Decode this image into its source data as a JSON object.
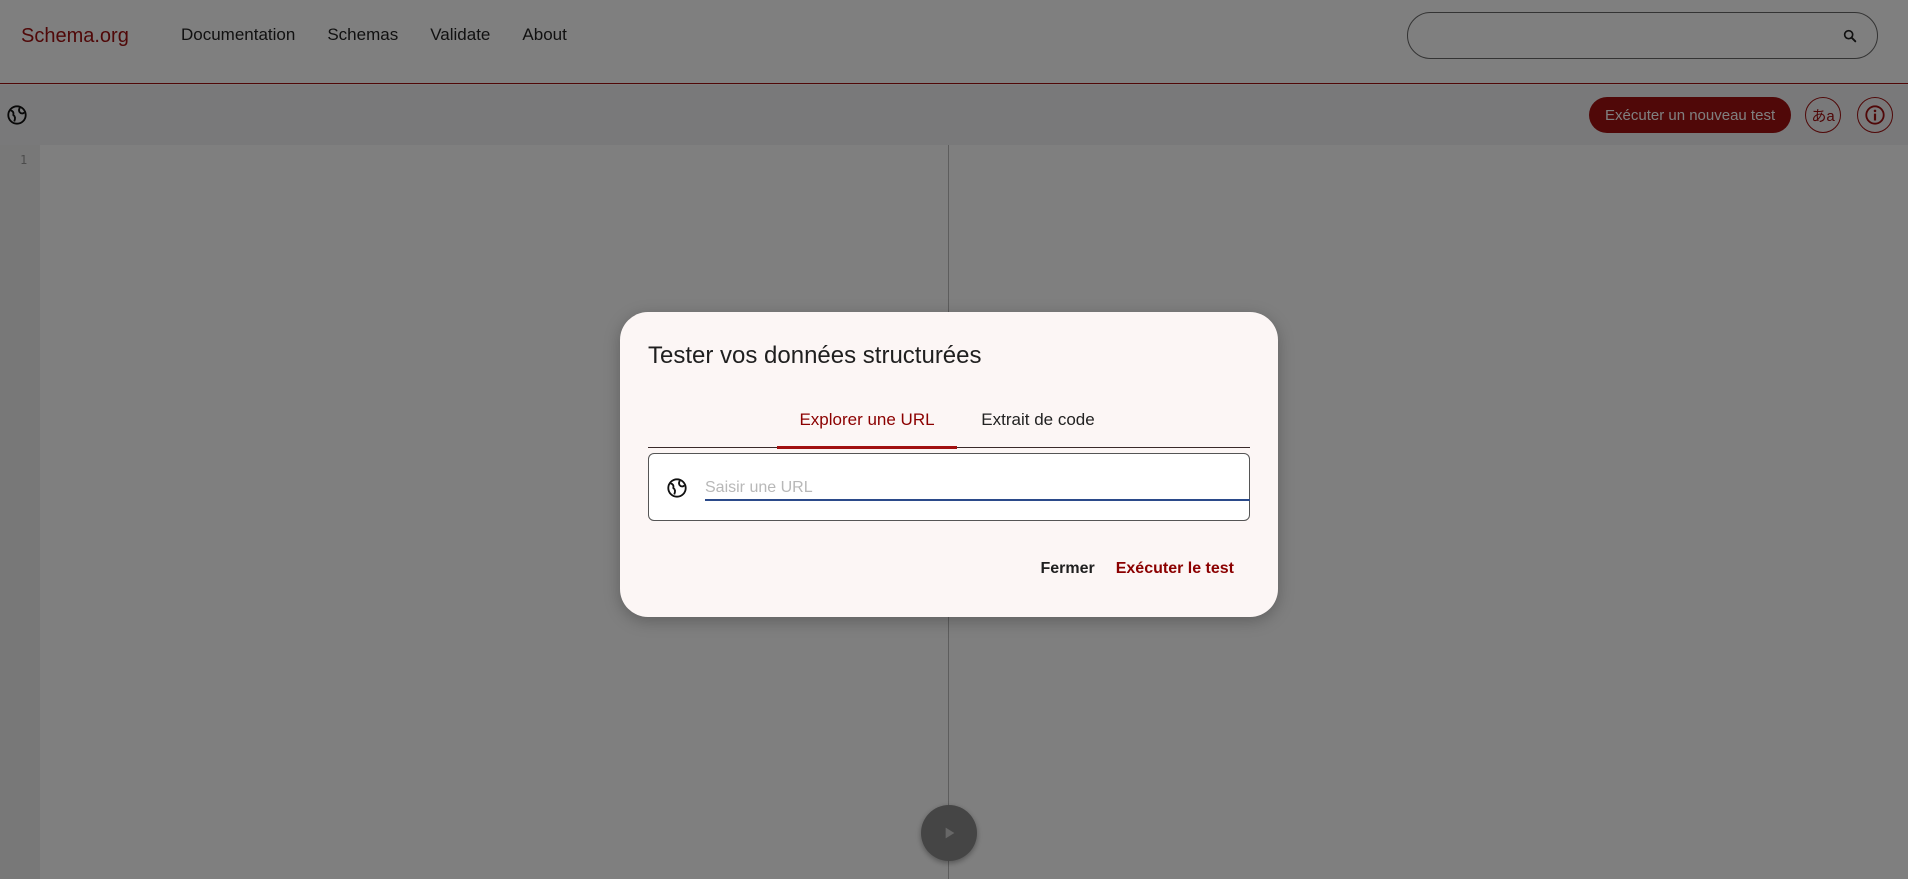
{
  "header": {
    "logo": "Schema.org",
    "nav": [
      {
        "label": "Documentation"
      },
      {
        "label": "Schemas"
      },
      {
        "label": "Validate"
      },
      {
        "label": "About"
      }
    ],
    "search_icon": "search-icon"
  },
  "toolbar": {
    "run_new_test_label": "Exécuter un nouveau test",
    "language_label": "あa",
    "info_icon": "info-icon",
    "globe_icon": "globe-icon"
  },
  "editor": {
    "line_numbers": [
      "1"
    ]
  },
  "dialog": {
    "title": "Tester vos données structurées",
    "tabs": [
      {
        "label": "Explorer une URL",
        "active": true
      },
      {
        "label": "Extrait de code",
        "active": false
      }
    ],
    "url_input": {
      "placeholder": "Saisir une URL",
      "value": ""
    },
    "close_label": "Fermer",
    "run_label": "Exécuter le test"
  },
  "colors": {
    "brand": "#a11010",
    "active_tab": "#8b0000",
    "overlay": "rgba(0,0,0,0.5)"
  }
}
